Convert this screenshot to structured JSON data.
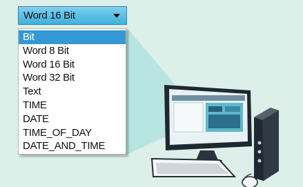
{
  "dropdown": {
    "selected": "Word 16 Bit",
    "options": [
      "Bit",
      "Word 8 Bit",
      "Word 16 Bit",
      "Word 32 Bit",
      "Text",
      "TIME",
      "DATE",
      "TIME_OF_DAY",
      "DATE_AND_TIME"
    ],
    "highlighted_index": 0
  },
  "colors": {
    "background": "#dcefe8",
    "beam": "#b8e5e2",
    "combo_fill": "#52bde6",
    "highlight": "#3399d6",
    "tower": "#2f3a44",
    "monitor_screen": "#5fb9c9"
  },
  "illustration": {
    "icons": [
      "computer-monitor-icon",
      "pc-tower-icon",
      "keyboard-icon",
      "mouse-icon"
    ]
  }
}
